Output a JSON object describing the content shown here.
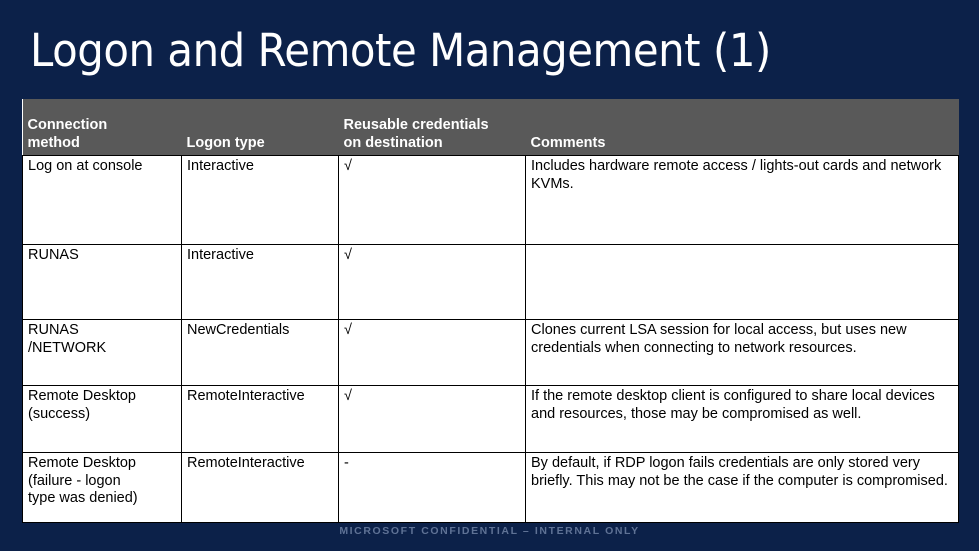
{
  "slide": {
    "title": "Logon and Remote Management (1)",
    "background_color": "#0c2149",
    "title_color": "#ffffff",
    "header_background_color": "#595959",
    "footer_text": "MICROSOFT CONFIDENTIAL – INTERNAL ONLY",
    "footer_color": "#5f7295"
  },
  "table": {
    "headers": {
      "connection_method_line1": "Connection",
      "connection_method_line2": "method",
      "logon_type": "Logon type",
      "reusable_credentials_line1": "Reusable credentials",
      "reusable_credentials_line2": "on destination",
      "comments": "Comments"
    },
    "rows": [
      {
        "method_line1": "Log on at console",
        "method_line2": "",
        "method_line3": "",
        "logon_type": "Interactive",
        "credentials": "√",
        "comments": "Includes hardware remote access / lights-out cards and network KVMs."
      },
      {
        "method_line1": "RUNAS",
        "method_line2": "",
        "method_line3": "",
        "logon_type": "Interactive",
        "credentials": "√",
        "comments": ""
      },
      {
        "method_line1": "RUNAS",
        "method_line2": "/NETWORK",
        "method_line3": "",
        "logon_type": "NewCredentials",
        "credentials": "√",
        "comments": "Clones current LSA session for local access, but uses new credentials when connecting to network resources."
      },
      {
        "method_line1": "Remote Desktop",
        "method_line2": "(success)",
        "method_line3": "",
        "logon_type": "RemoteInteractive",
        "credentials": "√",
        "comments": "If the remote desktop client is configured to share local devices and resources, those may be compromised as well."
      },
      {
        "method_line1": "Remote Desktop",
        "method_line2": "(failure - logon",
        "method_line3": "type was denied)",
        "logon_type": "RemoteInteractive",
        "credentials": "-",
        "comments": "By default, if RDP logon fails credentials are only stored very briefly. This may not be the case if the computer is compromised."
      }
    ]
  }
}
